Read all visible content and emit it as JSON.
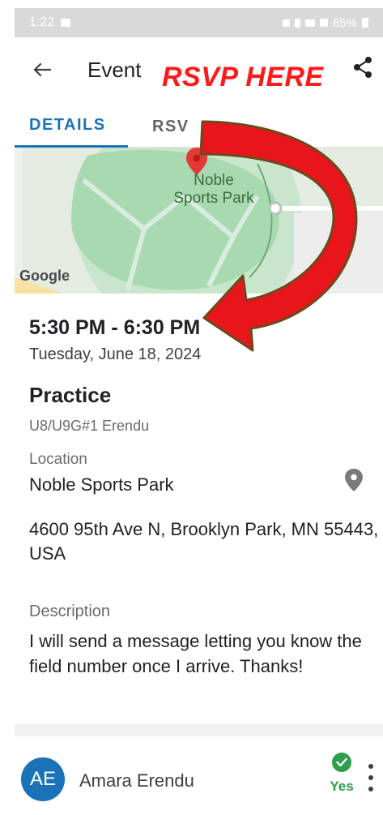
{
  "status_bar": {
    "time": "1:22",
    "battery": "85%"
  },
  "app_bar": {
    "title": "Event",
    "callout": "RSVP HERE"
  },
  "tabs": [
    {
      "label": "DETAILS",
      "active": true
    },
    {
      "label": "RSV",
      "active": false
    }
  ],
  "map": {
    "place_name_line1": "Noble",
    "place_name_line2": "Sports Park",
    "provider": "Google"
  },
  "event": {
    "time_range": "5:30 PM - 6:30 PM",
    "date": "Tuesday, June 18, 2024",
    "title": "Practice",
    "team": "U8/U9G#1 Erendu",
    "location_label": "Location",
    "location_name": "Noble Sports Park",
    "address": "4600 95th Ave N, Brooklyn Park, MN 55443, USA",
    "description_label": "Description",
    "description": "I will send a message letting you know the field number once I arrive. Thanks!"
  },
  "attendee": {
    "initials": "AE",
    "name": "Amara Erendu",
    "status": "Yes"
  },
  "colors": {
    "accent": "#1a73b8",
    "callout_red": "#ff1a1a",
    "arrow_red": "#e8151a",
    "arrow_outline": "#6b4a1e",
    "status_green": "#2e9e4a"
  },
  "icons": [
    "back-arrow-icon",
    "share-icon",
    "map-pin-icon",
    "location-pin-icon",
    "check-icon",
    "more-vert-icon"
  ]
}
